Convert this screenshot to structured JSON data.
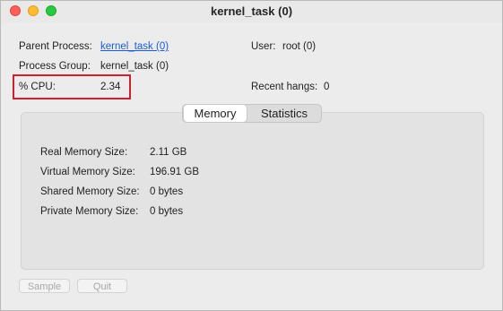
{
  "window": {
    "title": "kernel_task (0)"
  },
  "info": {
    "parent_process_label": "Parent Process:",
    "parent_process_value": "kernel_task (0)",
    "process_group_label": "Process Group:",
    "process_group_value": "kernel_task (0)",
    "cpu_label": "% CPU:",
    "cpu_value": "2.34",
    "user_label": "User:",
    "user_value": "root (0)",
    "recent_hangs_label": "Recent hangs:",
    "recent_hangs_value": "0"
  },
  "tabs": [
    {
      "label": "Memory",
      "selected": true
    },
    {
      "label": "Statistics",
      "selected": false
    }
  ],
  "memory": [
    {
      "label": "Real Memory Size:",
      "value": "2.11 GB"
    },
    {
      "label": "Virtual Memory Size:",
      "value": "196.91 GB"
    },
    {
      "label": "Shared Memory Size:",
      "value": "0 bytes"
    },
    {
      "label": "Private Memory Size:",
      "value": "0 bytes"
    }
  ],
  "buttons": {
    "sample_label": "Sample",
    "quit_label": "Quit"
  },
  "colors": {
    "highlight_border": "#d0202a",
    "link": "#1d5bd8",
    "window_bg": "#ececec"
  }
}
